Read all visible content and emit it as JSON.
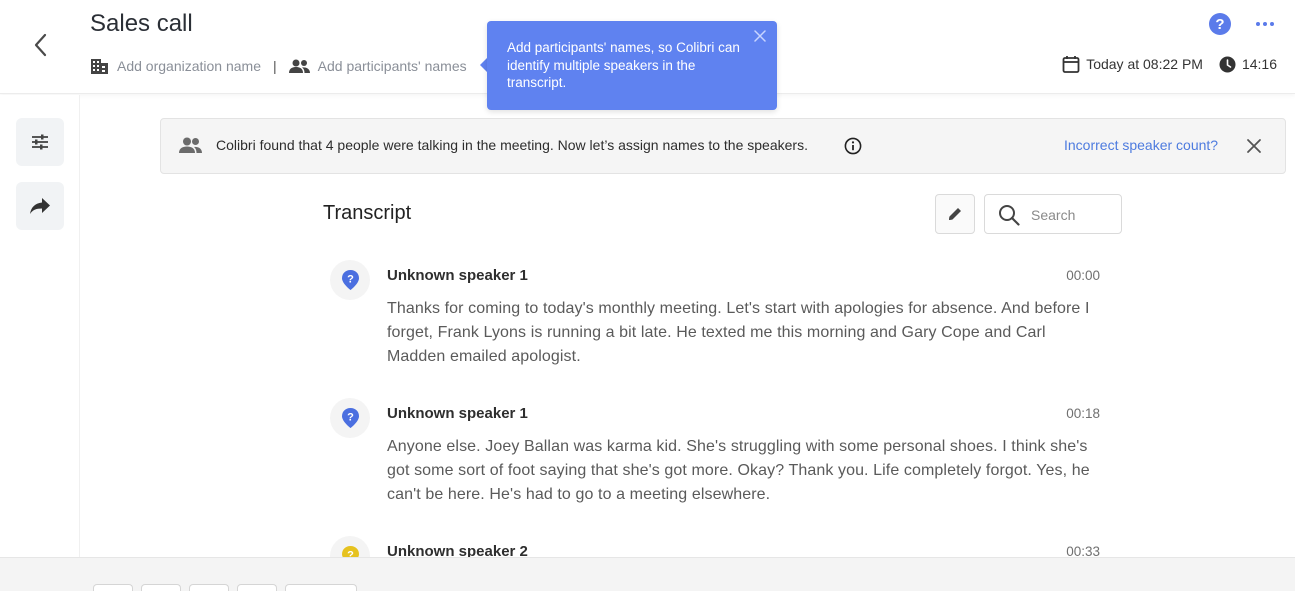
{
  "header": {
    "title": "Sales call",
    "org_placeholder": "Add organization name",
    "separator": "|",
    "participants_placeholder": "Add participants' names",
    "date": "Today at 08:22 PM",
    "duration": "14:16",
    "help_symbol": "?"
  },
  "tooltip": {
    "text": "Add participants' names, so Colibri can identify multiple speakers in the transcript."
  },
  "banner": {
    "text": "Colibri found that 4 people were talking in the meeting. Now let’s assign names to the speakers.",
    "link": "Incorrect speaker count?"
  },
  "transcript": {
    "title": "Transcript",
    "search_placeholder": "Search",
    "entries": [
      {
        "speaker": "Unknown speaker 1",
        "time": "00:00",
        "text": "Thanks for coming to today's monthly meeting. Let's start with apologies for absence. And before I forget, Frank Lyons is running a bit late. He texted me this morning and Gary Cope and Carl Madden emailed apologist.",
        "color": "#4b6fe0"
      },
      {
        "speaker": "Unknown speaker 1",
        "time": "00:18",
        "text": "Anyone else. Joey Ballan was karma kid. She's struggling with some personal shoes. I think she's got some sort of foot saying that she's got more. Okay? Thank you. Life completely forgot. Yes, he can't be here. He's had to go to a meeting elsewhere.",
        "color": "#4b6fe0"
      },
      {
        "speaker": "Unknown speaker 2",
        "time": "00:33",
        "text": "",
        "color": "#e6c21f"
      }
    ]
  },
  "icons": {
    "back": "chevron-left-icon",
    "org": "building-icon",
    "participants": "people-icon",
    "calendar": "calendar-icon",
    "clock": "clock-icon",
    "help": "help-icon",
    "more": "more-horizontal-icon",
    "settings": "sliders-icon",
    "share": "share-arrow-icon",
    "info": "info-icon",
    "close": "close-icon",
    "edit": "pencil-icon",
    "search": "search-icon"
  },
  "colors": {
    "accent": "#5b7bea",
    "tooltip_bg": "#5f82f0",
    "link": "#4d7bdf"
  }
}
